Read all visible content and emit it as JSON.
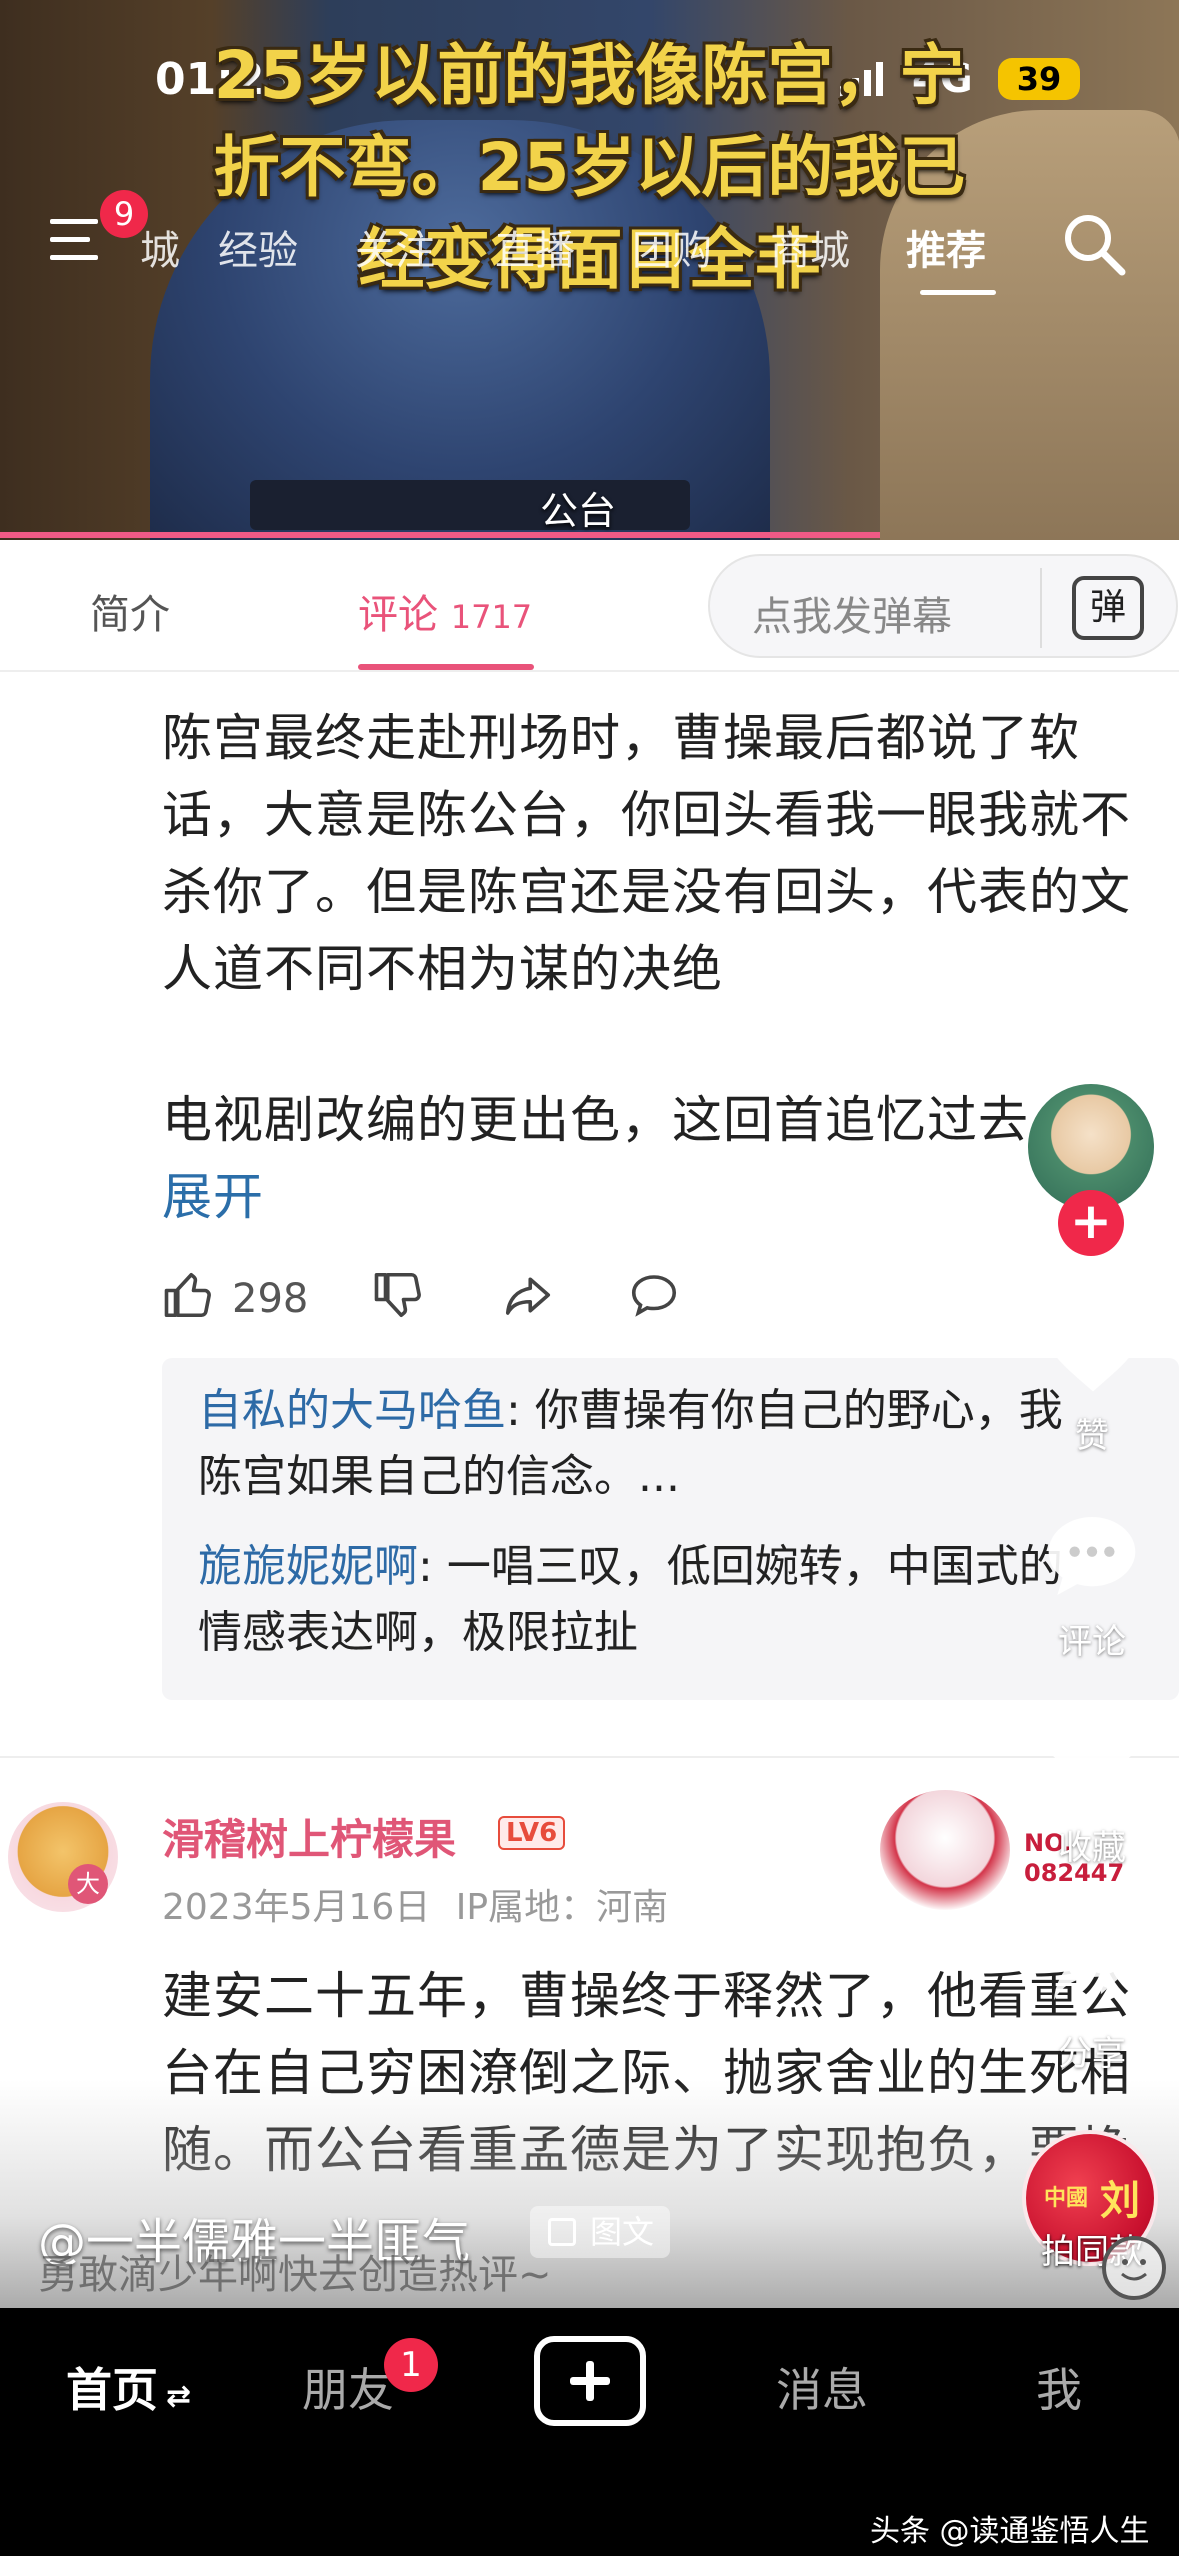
{
  "status_bar": {
    "time": "01:25",
    "network": "4G",
    "battery": "39"
  },
  "video": {
    "caption": "25岁以前的我像陈宫，宁折不弯。25岁以后的我已经变得面目全非",
    "caption_lines": [
      "25岁以前的我像陈宫，宁",
      "折不弯。25岁以后的我已",
      "经变得面目全非"
    ],
    "subtitle": "公台",
    "menu_badge": "9",
    "nav_tabs": [
      "城",
      "经验",
      "关注",
      "直播",
      "团购",
      "商城",
      "推荐"
    ]
  },
  "panel": {
    "tabs": {
      "intro": "简介",
      "comments": "评论",
      "comment_count": "1717"
    },
    "danmu_placeholder": "点我发弹幕",
    "danmu_icon_label": "弹",
    "comment1": {
      "para1": "陈宫最终走赴刑场时，曹操最后都说了软话，大意是陈公台，你回头看我一眼我就不杀你了。但是陈宫还是没有回头，代表的文人道不同不相为谋的决绝",
      "para2": "电视剧改编的更出色，这回首追忆过去，",
      "expand": "展开",
      "likes": "298",
      "replies": [
        {
          "name": "自私的大马哈鱼",
          "text": "你曹操有你自己的野心，我陈宫如果自己的信念。..."
        },
        {
          "name": "旎旎妮妮啊",
          "text": "一唱三叹，低回婉转，中国式的情感表达啊，极限拉扯"
        }
      ]
    },
    "comment2": {
      "username": "滑稽树上柠檬果",
      "level": "LV6",
      "date": "2023年5月16日",
      "ip": "IP属地：河南",
      "badge_text": "NO.",
      "badge_number": "082447",
      "avatar_tag": "大",
      "text": "建安二十五年，曹操终于释然了，他看重公台在自己穷困潦倒之际、抛家舍业的生死相随。而公台看重孟德是为了实现抱负，要挽"
    }
  },
  "overlay": {
    "author": "@一半儒雅一半匪气",
    "type_label": "图文",
    "prompt": "勇敢滴少年啊快去创造热评~"
  },
  "right_rail": {
    "like_label": "赞",
    "comment_label": "评论",
    "collect_label": "收藏",
    "share_label": "分享",
    "same_label": "拍同款",
    "same_stamp": "刘",
    "same_stamp_small": "中國"
  },
  "bottom_nav": {
    "home": "首页",
    "friends": "朋友",
    "friends_badge": "1",
    "messages": "消息",
    "me": "我"
  },
  "watermark": "头条 @读通鉴悟人生"
}
